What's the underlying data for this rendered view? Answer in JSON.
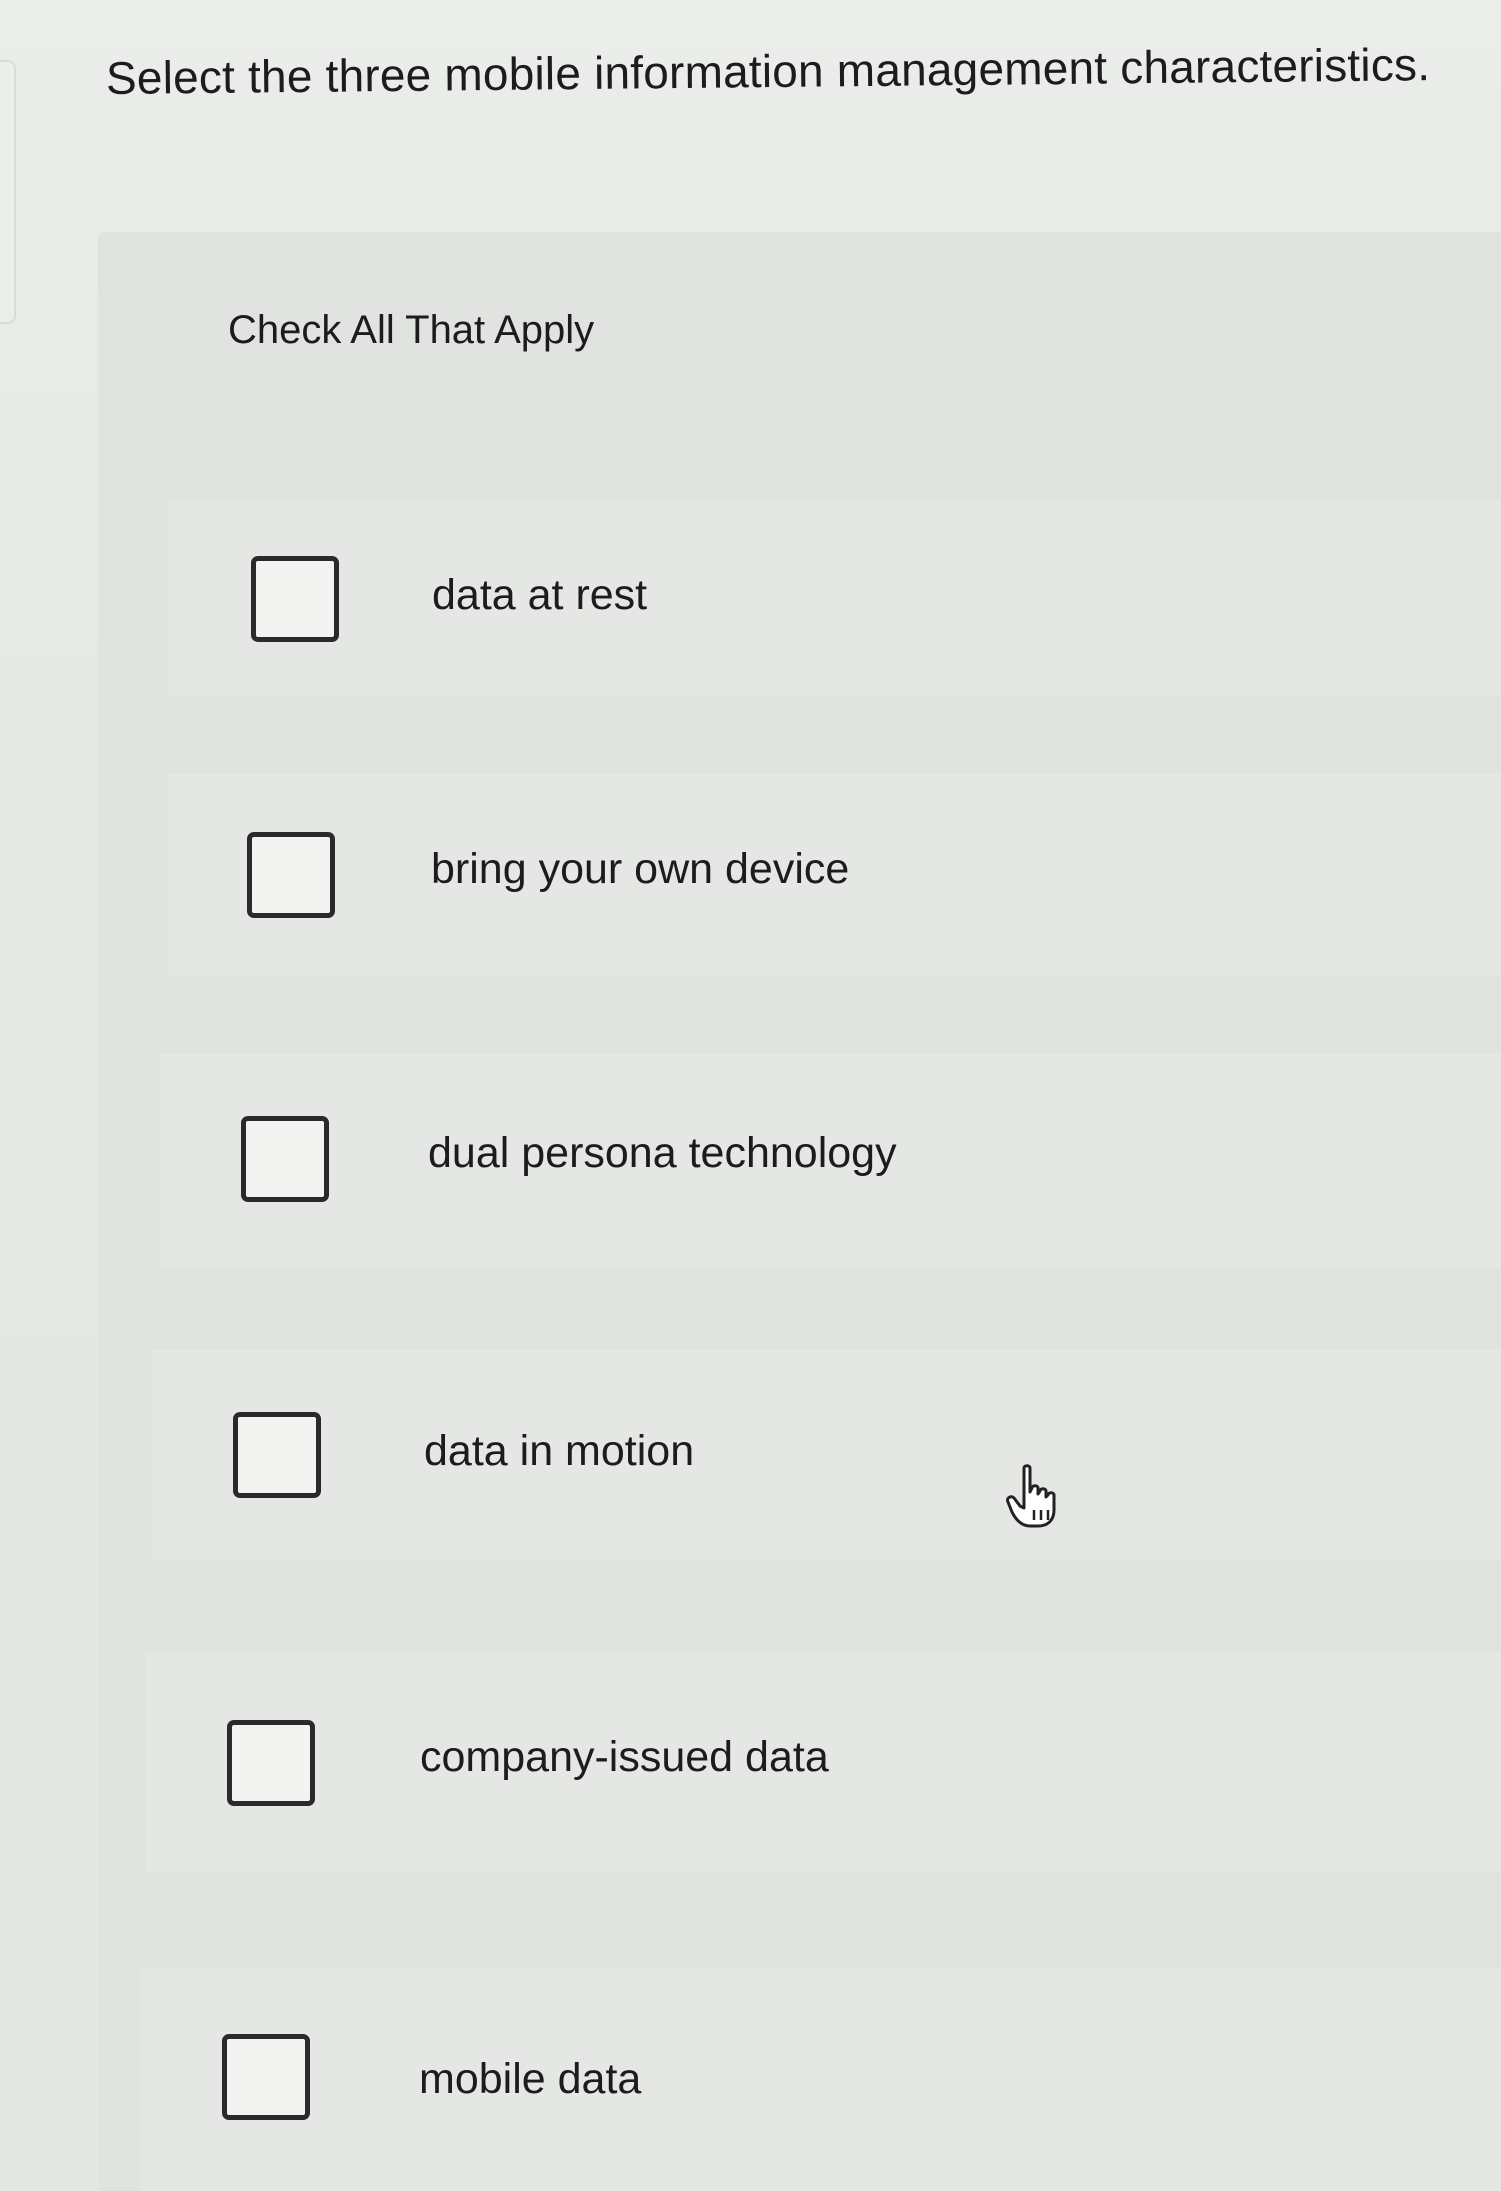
{
  "question": {
    "text": "Select the three mobile information management characteristics."
  },
  "instruction": {
    "text": "Check All That Apply"
  },
  "options": [
    {
      "label": "data at rest",
      "checked": false
    },
    {
      "label": "bring your own device",
      "checked": false
    },
    {
      "label": "dual persona technology",
      "checked": false
    },
    {
      "label": "data in motion",
      "checked": false
    },
    {
      "label": "company-issued data",
      "checked": false
    },
    {
      "label": "mobile data",
      "checked": false
    }
  ],
  "icons": {
    "cursor": "pointer-hand-icon"
  }
}
